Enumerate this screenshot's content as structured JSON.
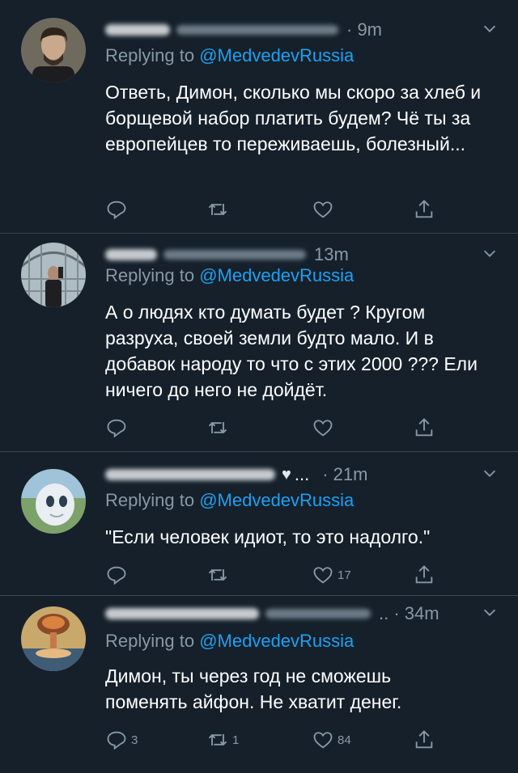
{
  "reply_prefix": "Replying to",
  "tweets": [
    {
      "time": "· 9m",
      "mention": "@MedvedevRussia",
      "text": "Ответь, Димон, сколько мы скоро за хлеб и борщевой набор платить будем? Чё ты за европейцев то переживаешь, болезный...",
      "reply_count": "",
      "retweet_count": "",
      "like_count": ""
    },
    {
      "time": "13m",
      "mention": "@MedvedevRussia",
      "text": "А о людях кто думать будет ? Кругом разруха, своей земли будто мало. И в добавок народу то что с этих 2000 ??? Ели ничего до него не дойдёт.",
      "reply_count": "",
      "retweet_count": "",
      "like_count": ""
    },
    {
      "time": "· 21m",
      "mention": "@MedvedevRussia",
      "text": "\"Если человек идиот, то это надолго.\"",
      "reply_count": "",
      "retweet_count": "",
      "like_count": "17"
    },
    {
      "time": ".. · 34m",
      "mention": "@MedvedevRussia",
      "text": "Димон, ты через год не сможешь поменять айфон. Не хватит денег.",
      "reply_count": "3",
      "retweet_count": "1",
      "like_count": "84"
    }
  ],
  "colors": {
    "background": "#15202b",
    "secondary_text": "#8899a6",
    "mention": "#1da1f2",
    "divider": "#38444d"
  },
  "icons": [
    "reply-icon",
    "retweet-icon",
    "like-icon",
    "share-icon",
    "chevron-down-icon"
  ]
}
